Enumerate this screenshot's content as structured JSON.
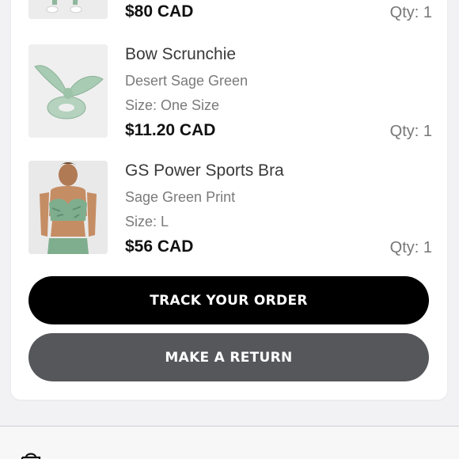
{
  "order_items": [
    {
      "name": "",
      "variant": "",
      "size": "",
      "price": "$80 CAD",
      "qty": "Qty: 1",
      "image": "leggings-product-photo"
    },
    {
      "name": "Bow Scrunchie",
      "variant": "Desert Sage Green",
      "size": "Size: One Size",
      "price": "$11.20 CAD",
      "qty": "Qty: 1",
      "image": "scrunchie-product-photo"
    },
    {
      "name": "GS Power Sports Bra",
      "variant": "Sage Green Print",
      "size": "Size: L",
      "price": "$56 CAD",
      "qty": "Qty: 1",
      "image": "sports-bra-product-photo"
    }
  ],
  "actions": {
    "track_label": "TRACK YOUR ORDER",
    "return_label": "MAKE A RETURN"
  },
  "colors": {
    "track_button": "#000000",
    "return_button": "#56575b",
    "sage_green": "#a6c9b0"
  },
  "bottom_nav": {
    "icon": "shopping-bag-icon"
  }
}
